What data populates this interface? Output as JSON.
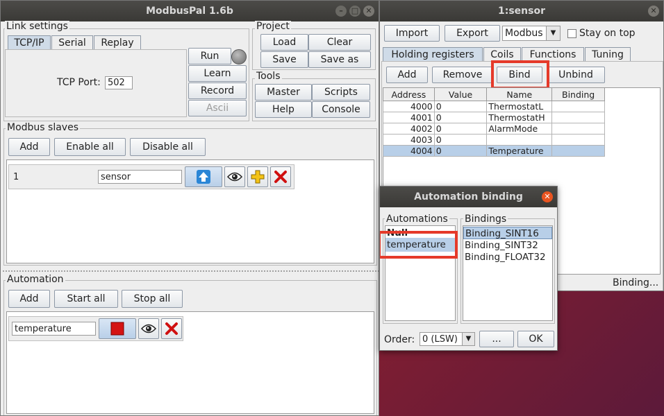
{
  "main_window": {
    "title": "ModbusPal 1.6b",
    "link_settings": {
      "title": "Link settings",
      "tabs": [
        "TCP/IP",
        "Serial",
        "Replay"
      ],
      "tcp_port_label": "TCP Port:",
      "tcp_port_value": "502",
      "run_label": "Run",
      "learn_label": "Learn",
      "record_label": "Record",
      "ascii_label": "Ascii"
    },
    "project": {
      "title": "Project",
      "load": "Load",
      "clear": "Clear",
      "save": "Save",
      "save_as": "Save as"
    },
    "tools": {
      "title": "Tools",
      "master": "Master",
      "scripts": "Scripts",
      "help": "Help",
      "console": "Console"
    },
    "slaves": {
      "title": "Modbus slaves",
      "add": "Add",
      "enable_all": "Enable all",
      "disable_all": "Disable all",
      "row": {
        "id": "1",
        "name": "sensor"
      }
    },
    "automation": {
      "title": "Automation",
      "add": "Add",
      "start_all": "Start all",
      "stop_all": "Stop all",
      "row": {
        "name": "temperature"
      }
    }
  },
  "sensor_window": {
    "title": "1:sensor",
    "import": "Import",
    "export": "Export",
    "protocol_value": "Modbus",
    "stay_on_top": "Stay on top",
    "tabs": [
      "Holding registers",
      "Coils",
      "Functions",
      "Tuning"
    ],
    "add": "Add",
    "remove": "Remove",
    "bind": "Bind",
    "unbind": "Unbind",
    "columns": [
      "Address",
      "Value",
      "Name",
      "Binding"
    ],
    "rows": [
      {
        "address": "4000",
        "value": "0",
        "name": "ThermostatL",
        "binding": ""
      },
      {
        "address": "4001",
        "value": "0",
        "name": "ThermostatH",
        "binding": ""
      },
      {
        "address": "4002",
        "value": "0",
        "name": "AlarmMode",
        "binding": ""
      },
      {
        "address": "4003",
        "value": "0",
        "name": "",
        "binding": ""
      },
      {
        "address": "4004",
        "value": "0",
        "name": "Temperature",
        "binding": ""
      }
    ],
    "status": "Binding..."
  },
  "dialog": {
    "title": "Automation binding",
    "automations_title": "Automations",
    "automations": [
      "Null",
      "temperature"
    ],
    "bindings_title": "Bindings",
    "bindings": [
      "Binding_SINT16",
      "Binding_SINT32",
      "Binding_FLOAT32"
    ],
    "order_label": "Order:",
    "order_value": "0 (LSW)",
    "more": "...",
    "ok": "OK"
  },
  "colors": {
    "highlight": "#e53a2a",
    "selection": "#b8cfe8",
    "titlebar": "#3f3e3b"
  }
}
